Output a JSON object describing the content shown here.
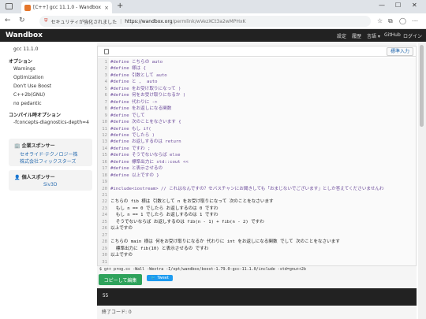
{
  "browser": {
    "tab_title": "[C++] gcc 11.1.0 - Wandbox",
    "tab_close": "×",
    "new_tab": "+",
    "security_label": "セキュリティが強化されました",
    "url_host": "https://wandbox.org",
    "url_path": "/permlink/wVezXCt3a2wMPHxK",
    "minimize": "—",
    "maximize": "☐",
    "close": "✕"
  },
  "header": {
    "brand": "Wandbox",
    "nav": [
      "設定",
      "履歴",
      "言語 ▾",
      "GitHub",
      "ログイン"
    ]
  },
  "sidebar": {
    "compiler": "gcc 11.1.0",
    "options_heading": "オプション",
    "options": [
      "Warnings",
      "Optimization",
      "Don't Use Boost",
      "C++2b(GNU)",
      "no pedantic"
    ],
    "compile_opts_heading": "コンパイル時オプション",
    "compile_opts": "-fconcepts-diagnostics-depth=4",
    "corp_heading": "企業スポンサー",
    "corp_links": [
      "セオライド·テクノロジー株",
      "株式会社フィックスターズ"
    ],
    "personal_heading": "個人スポンサー",
    "personal_links": [
      "Siv3D"
    ]
  },
  "editor": {
    "stdin_button": "標準入力",
    "lines": [
      {
        "n": "1",
        "t": "#define こちらの auto"
      },
      {
        "n": "2",
        "t": "#define 様は {"
      },
      {
        "n": "3",
        "t": "#define 引数として auto"
      },
      {
        "n": "4",
        "t": "#define と ,  auto"
      },
      {
        "n": "5",
        "t": "#define をお受け取りになって )"
      },
      {
        "n": "6",
        "t": "#define 何をお受け取りになるか )"
      },
      {
        "n": "7",
        "t": "#define 代わりに ->"
      },
      {
        "n": "8",
        "t": "#define をお返しになる関数"
      },
      {
        "n": "9",
        "t": "#define でして"
      },
      {
        "n": "10",
        "t": "#define 次のことをなさいます {"
      },
      {
        "n": "11",
        "t": "#define もし if("
      },
      {
        "n": "12",
        "t": "#define でしたら )"
      },
      {
        "n": "13",
        "t": "#define お返しするのは return"
      },
      {
        "n": "14",
        "t": "#define ですわ ;"
      },
      {
        "n": "15",
        "t": "#define そうでないならば else"
      },
      {
        "n": "16",
        "t": "#define 標準出力に std::cout <<"
      },
      {
        "n": "17",
        "t": "#define と表示させるの"
      },
      {
        "n": "18",
        "t": "#define 以上ですの }"
      },
      {
        "n": "19",
        "t": ""
      },
      {
        "n": "20",
        "t": "#include<iostream> // これはなんですの？セバスチャンにお聞きしても「おまじないでございます」としか答えてくださいませんわ"
      },
      {
        "n": "21",
        "t": ""
      },
      {
        "n": "22",
        "t": "こちらの fib 様は 引数として n をお受け取りになって 次のことをなさいます"
      },
      {
        "n": "23",
        "t": "  もし n == 0 でしたら お返しするのは 0 ですわ"
      },
      {
        "n": "24",
        "t": "  もし n == 1 でしたら お返しするのは 1 ですわ"
      },
      {
        "n": "25",
        "t": "  そうでないならば お返しするのは fib(n - 1) + fib(n - 2) ですわ"
      },
      {
        "n": "26",
        "t": "以上ですの"
      },
      {
        "n": "27",
        "t": ""
      },
      {
        "n": "28",
        "t": "こちらの main 様は 何をお受け取りになるか 代わりに int をお返しになる関数 でして 次のことをなさいます"
      },
      {
        "n": "29",
        "t": "  標準出力に fib(10) と表示させるの ですわ"
      },
      {
        "n": "30",
        "t": "以上ですの"
      },
      {
        "n": "31",
        "t": ""
      }
    ]
  },
  "command": "$ g++ prog.cc -Wall -Wextra -I/opt/wandbox/boost-1.79.0-gcc-11.1.0/include -std=gnu++2b",
  "run_button": "コピーして編集",
  "tweet_button": "Tweet",
  "output": "55",
  "exit_code": "終了コード: 0"
}
